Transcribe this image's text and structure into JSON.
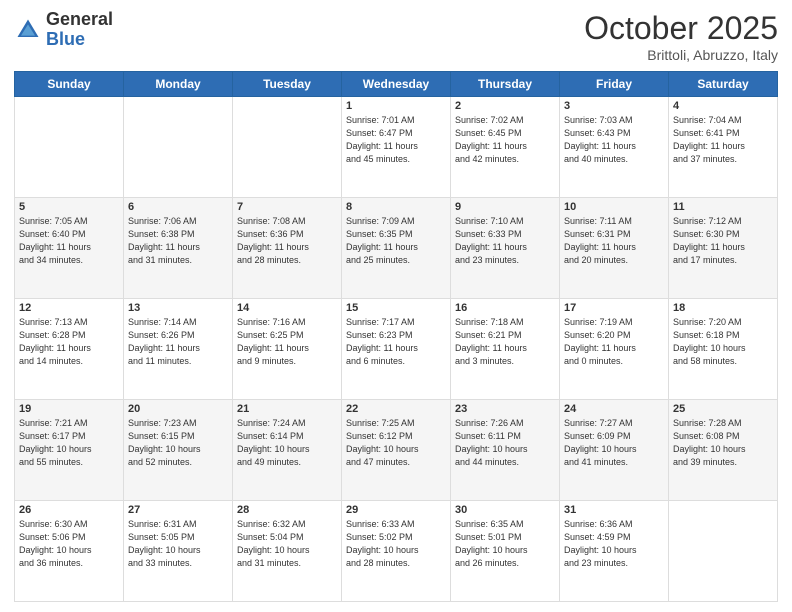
{
  "logo": {
    "general": "General",
    "blue": "Blue"
  },
  "header": {
    "title": "October 2025",
    "subtitle": "Brittoli, Abruzzo, Italy"
  },
  "days_of_week": [
    "Sunday",
    "Monday",
    "Tuesday",
    "Wednesday",
    "Thursday",
    "Friday",
    "Saturday"
  ],
  "weeks": [
    [
      {
        "day": "",
        "info": ""
      },
      {
        "day": "",
        "info": ""
      },
      {
        "day": "",
        "info": ""
      },
      {
        "day": "1",
        "info": "Sunrise: 7:01 AM\nSunset: 6:47 PM\nDaylight: 11 hours\nand 45 minutes."
      },
      {
        "day": "2",
        "info": "Sunrise: 7:02 AM\nSunset: 6:45 PM\nDaylight: 11 hours\nand 42 minutes."
      },
      {
        "day": "3",
        "info": "Sunrise: 7:03 AM\nSunset: 6:43 PM\nDaylight: 11 hours\nand 40 minutes."
      },
      {
        "day": "4",
        "info": "Sunrise: 7:04 AM\nSunset: 6:41 PM\nDaylight: 11 hours\nand 37 minutes."
      }
    ],
    [
      {
        "day": "5",
        "info": "Sunrise: 7:05 AM\nSunset: 6:40 PM\nDaylight: 11 hours\nand 34 minutes."
      },
      {
        "day": "6",
        "info": "Sunrise: 7:06 AM\nSunset: 6:38 PM\nDaylight: 11 hours\nand 31 minutes."
      },
      {
        "day": "7",
        "info": "Sunrise: 7:08 AM\nSunset: 6:36 PM\nDaylight: 11 hours\nand 28 minutes."
      },
      {
        "day": "8",
        "info": "Sunrise: 7:09 AM\nSunset: 6:35 PM\nDaylight: 11 hours\nand 25 minutes."
      },
      {
        "day": "9",
        "info": "Sunrise: 7:10 AM\nSunset: 6:33 PM\nDaylight: 11 hours\nand 23 minutes."
      },
      {
        "day": "10",
        "info": "Sunrise: 7:11 AM\nSunset: 6:31 PM\nDaylight: 11 hours\nand 20 minutes."
      },
      {
        "day": "11",
        "info": "Sunrise: 7:12 AM\nSunset: 6:30 PM\nDaylight: 11 hours\nand 17 minutes."
      }
    ],
    [
      {
        "day": "12",
        "info": "Sunrise: 7:13 AM\nSunset: 6:28 PM\nDaylight: 11 hours\nand 14 minutes."
      },
      {
        "day": "13",
        "info": "Sunrise: 7:14 AM\nSunset: 6:26 PM\nDaylight: 11 hours\nand 11 minutes."
      },
      {
        "day": "14",
        "info": "Sunrise: 7:16 AM\nSunset: 6:25 PM\nDaylight: 11 hours\nand 9 minutes."
      },
      {
        "day": "15",
        "info": "Sunrise: 7:17 AM\nSunset: 6:23 PM\nDaylight: 11 hours\nand 6 minutes."
      },
      {
        "day": "16",
        "info": "Sunrise: 7:18 AM\nSunset: 6:21 PM\nDaylight: 11 hours\nand 3 minutes."
      },
      {
        "day": "17",
        "info": "Sunrise: 7:19 AM\nSunset: 6:20 PM\nDaylight: 11 hours\nand 0 minutes."
      },
      {
        "day": "18",
        "info": "Sunrise: 7:20 AM\nSunset: 6:18 PM\nDaylight: 10 hours\nand 58 minutes."
      }
    ],
    [
      {
        "day": "19",
        "info": "Sunrise: 7:21 AM\nSunset: 6:17 PM\nDaylight: 10 hours\nand 55 minutes."
      },
      {
        "day": "20",
        "info": "Sunrise: 7:23 AM\nSunset: 6:15 PM\nDaylight: 10 hours\nand 52 minutes."
      },
      {
        "day": "21",
        "info": "Sunrise: 7:24 AM\nSunset: 6:14 PM\nDaylight: 10 hours\nand 49 minutes."
      },
      {
        "day": "22",
        "info": "Sunrise: 7:25 AM\nSunset: 6:12 PM\nDaylight: 10 hours\nand 47 minutes."
      },
      {
        "day": "23",
        "info": "Sunrise: 7:26 AM\nSunset: 6:11 PM\nDaylight: 10 hours\nand 44 minutes."
      },
      {
        "day": "24",
        "info": "Sunrise: 7:27 AM\nSunset: 6:09 PM\nDaylight: 10 hours\nand 41 minutes."
      },
      {
        "day": "25",
        "info": "Sunrise: 7:28 AM\nSunset: 6:08 PM\nDaylight: 10 hours\nand 39 minutes."
      }
    ],
    [
      {
        "day": "26",
        "info": "Sunrise: 6:30 AM\nSunset: 5:06 PM\nDaylight: 10 hours\nand 36 minutes."
      },
      {
        "day": "27",
        "info": "Sunrise: 6:31 AM\nSunset: 5:05 PM\nDaylight: 10 hours\nand 33 minutes."
      },
      {
        "day": "28",
        "info": "Sunrise: 6:32 AM\nSunset: 5:04 PM\nDaylight: 10 hours\nand 31 minutes."
      },
      {
        "day": "29",
        "info": "Sunrise: 6:33 AM\nSunset: 5:02 PM\nDaylight: 10 hours\nand 28 minutes."
      },
      {
        "day": "30",
        "info": "Sunrise: 6:35 AM\nSunset: 5:01 PM\nDaylight: 10 hours\nand 26 minutes."
      },
      {
        "day": "31",
        "info": "Sunrise: 6:36 AM\nSunset: 4:59 PM\nDaylight: 10 hours\nand 23 minutes."
      },
      {
        "day": "",
        "info": ""
      }
    ]
  ]
}
